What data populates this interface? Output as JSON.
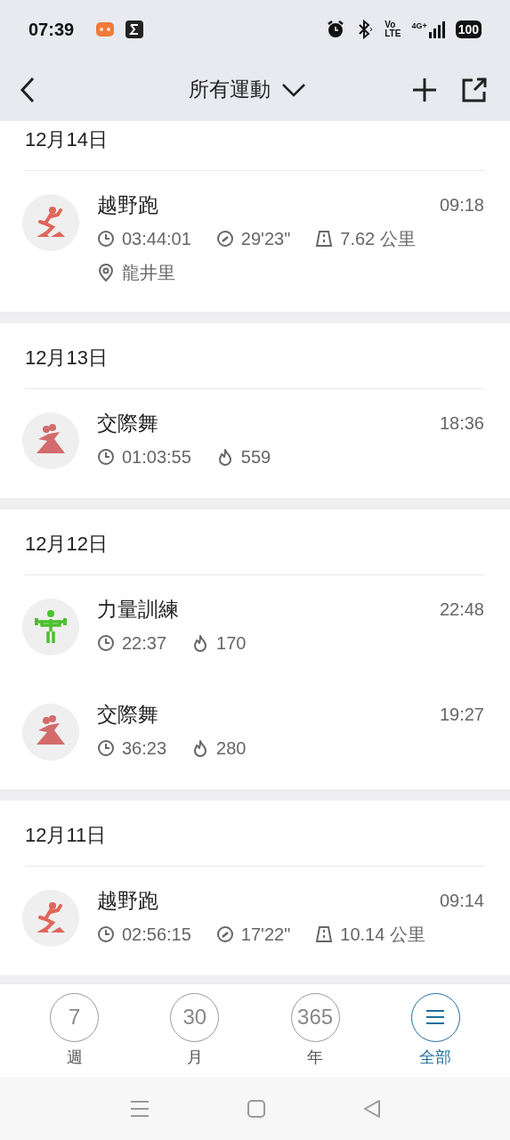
{
  "status_bar": {
    "time": "07:39",
    "volte_top": "Vo",
    "volte_bottom": "LTE",
    "network": "4G+",
    "battery": "100"
  },
  "header": {
    "title": "所有運動"
  },
  "sections": [
    {
      "date": "12月14日",
      "activities": [
        {
          "kind": "run",
          "name": "越野跑",
          "time": "09:18",
          "stats": [
            {
              "kind": "duration",
              "text": "03:44:01"
            },
            {
              "kind": "pace",
              "text": "29'23\""
            },
            {
              "kind": "distance",
              "text": "7.62 公里"
            }
          ],
          "location": "龍井里"
        }
      ]
    },
    {
      "date": "12月13日",
      "activities": [
        {
          "kind": "dance",
          "name": "交際舞",
          "time": "18:36",
          "stats": [
            {
              "kind": "duration",
              "text": "01:03:55"
            },
            {
              "kind": "calories",
              "text": "559"
            }
          ]
        }
      ]
    },
    {
      "date": "12月12日",
      "activities": [
        {
          "kind": "strength",
          "name": "力量訓練",
          "time": "22:48",
          "stats": [
            {
              "kind": "duration",
              "text": "22:37"
            },
            {
              "kind": "calories",
              "text": "170"
            }
          ]
        },
        {
          "kind": "dance",
          "name": "交際舞",
          "time": "19:27",
          "stats": [
            {
              "kind": "duration",
              "text": "36:23"
            },
            {
              "kind": "calories",
              "text": "280"
            }
          ]
        }
      ]
    },
    {
      "date": "12月11日",
      "activities": [
        {
          "kind": "run",
          "name": "越野跑",
          "time": "09:14",
          "stats": [
            {
              "kind": "duration",
              "text": "02:56:15"
            },
            {
              "kind": "pace",
              "text": "17'22\""
            },
            {
              "kind": "distance",
              "text": "10.14 公里"
            }
          ]
        }
      ]
    }
  ],
  "bottom_nav": [
    {
      "kind": "number",
      "value": "7",
      "label": "週",
      "selected": false
    },
    {
      "kind": "number",
      "value": "30",
      "label": "月",
      "selected": false
    },
    {
      "kind": "number",
      "value": "365",
      "label": "年",
      "selected": false
    },
    {
      "kind": "list",
      "label": "全部",
      "selected": true
    }
  ]
}
